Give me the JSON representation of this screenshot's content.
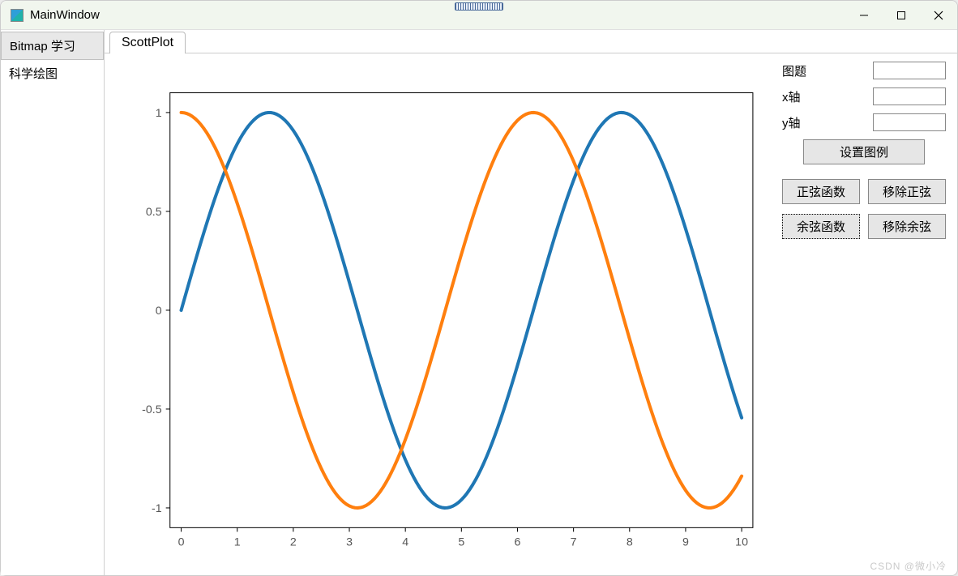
{
  "window": {
    "title": "MainWindow"
  },
  "sidebar": {
    "items": [
      {
        "label": "Bitmap 学习",
        "selected": true
      },
      {
        "label": "科学绘图",
        "selected": false
      }
    ]
  },
  "tab": {
    "label": "ScottPlot"
  },
  "panel": {
    "title_label": "图题",
    "xaxis_label": "x轴",
    "yaxis_label": "y轴",
    "title_value": "",
    "xaxis_value": "",
    "yaxis_value": "",
    "legend_btn": "设置图例",
    "sin_btn": "正弦函数",
    "remove_sin_btn": "移除正弦",
    "cos_btn": "余弦函数",
    "remove_cos_btn": "移除余弦"
  },
  "watermark": "CSDN @微小冷",
  "chart_data": {
    "type": "line",
    "x": [
      0,
      0.25,
      0.5,
      0.75,
      1,
      1.25,
      1.5,
      1.75,
      2,
      2.25,
      2.5,
      2.75,
      3,
      3.25,
      3.5,
      3.75,
      4,
      4.25,
      4.5,
      4.75,
      5,
      5.25,
      5.5,
      5.75,
      6,
      6.25,
      6.5,
      6.75,
      7,
      7.25,
      7.5,
      7.75,
      8,
      8.25,
      8.5,
      8.75,
      9,
      9.25,
      9.5,
      9.75,
      10
    ],
    "series": [
      {
        "name": "sin",
        "color": "#1f77b4",
        "fn": "sin(x)"
      },
      {
        "name": "cos",
        "color": "#ff7f0e",
        "fn": "cos(x)"
      }
    ],
    "xlim": [
      -0.2,
      10.2
    ],
    "ylim": [
      -1.1,
      1.1
    ],
    "xticks": [
      0,
      1,
      2,
      3,
      4,
      5,
      6,
      7,
      8,
      9,
      10
    ],
    "yticks": [
      -1,
      -0.5,
      0,
      0.5,
      1
    ],
    "title": "",
    "xlabel": "",
    "ylabel": ""
  }
}
